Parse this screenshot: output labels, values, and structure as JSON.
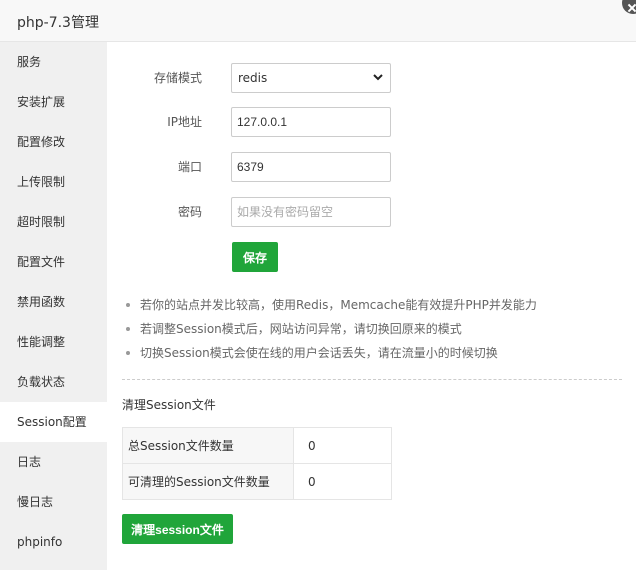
{
  "window": {
    "title": "php-7.3管理"
  },
  "sidebar": {
    "items": [
      {
        "label": "服务"
      },
      {
        "label": "安装扩展"
      },
      {
        "label": "配置修改"
      },
      {
        "label": "上传限制"
      },
      {
        "label": "超时限制"
      },
      {
        "label": "配置文件"
      },
      {
        "label": "禁用函数"
      },
      {
        "label": "性能调整"
      },
      {
        "label": "负载状态"
      },
      {
        "label": "Session配置",
        "active": true
      },
      {
        "label": "日志"
      },
      {
        "label": "慢日志"
      },
      {
        "label": "phpinfo"
      }
    ]
  },
  "form": {
    "storage_mode": {
      "label": "存储模式",
      "value": "redis"
    },
    "ip": {
      "label": "IP地址",
      "value": "127.0.0.1"
    },
    "port": {
      "label": "端口",
      "value": "6379"
    },
    "password": {
      "label": "密码",
      "value": "",
      "placeholder": "如果没有密码留空"
    },
    "save_label": "保存"
  },
  "tips": [
    "若你的站点并发比较高，使用Redis，Memcache能有效提升PHP并发能力",
    "若调整Session模式后，网站访问异常，请切换回原来的模式",
    "切换Session模式会使在线的用户会话丢失，请在流量小的时候切换"
  ],
  "cleanup": {
    "title": "清理Session文件",
    "rows": [
      {
        "label": "总Session文件数量",
        "value": "0"
      },
      {
        "label": "可清理的Session文件数量",
        "value": "0"
      }
    ],
    "button_label": "清理session文件"
  },
  "colors": {
    "accent": "#20a53a",
    "sidebar_bg": "#f0f0f0",
    "titlebar_bg": "#f8f8f8"
  },
  "icons": {
    "close": "close-icon",
    "select": "chevron-down-icon"
  }
}
